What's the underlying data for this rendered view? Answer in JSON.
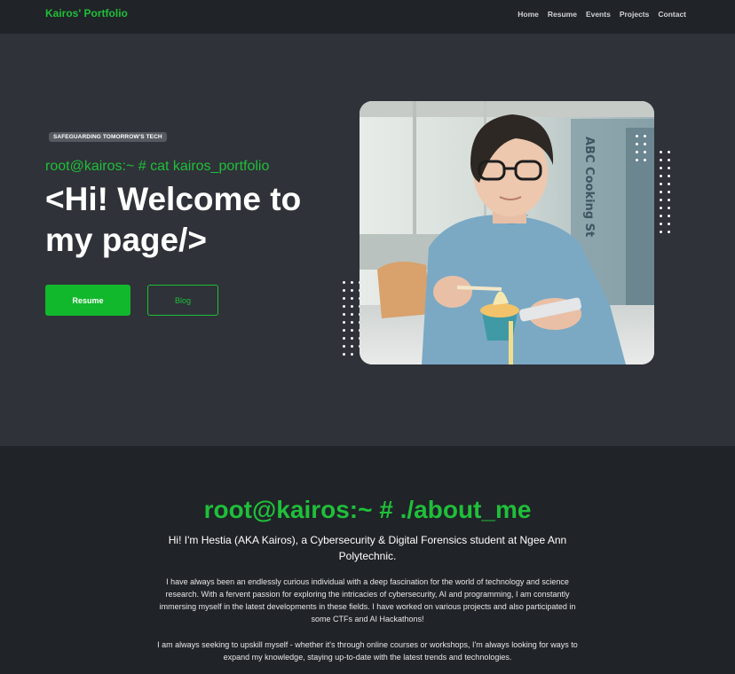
{
  "brand": "Kairos' Portfolio",
  "nav": [
    "Home",
    "Resume",
    "Events",
    "Projects",
    "Contact"
  ],
  "hero": {
    "tagline": "SAFEGUARDING TOMORROW'S TECH",
    "command": "root@kairos:~ # cat kairos_portfolio",
    "headline": "<Hi! Welcome to my page/>",
    "resume_label": "Resume",
    "blog_label": "Blog",
    "photo_sign_text": "ABC Cooking St"
  },
  "about": {
    "title": "root@kairos:~ # ./about_me",
    "intro": "Hi! I'm Hestia (AKA Kairos), a Cybersecurity & Digital Forensics student at Ngee Ann Polytechnic.",
    "p1": "I have always been an endlessly curious individual with a deep fascination for the world of technology and science research. With a fervent passion for exploring the intricacies of cybersecurity, AI and programming, I am constantly immersing myself in the latest developments in these fields. I have worked on various projects and also participated in some CTFs and AI Hackathons!",
    "p2": "I am always seeking to upskill myself - whether it's through online courses or workshops, I'm always looking for ways to expand my knowledge, staying up-to-date with the latest trends and technologies."
  },
  "colors": {
    "accent": "#1fbf3a",
    "nav_bg": "#202327",
    "hero_bg": "#2f3238"
  }
}
